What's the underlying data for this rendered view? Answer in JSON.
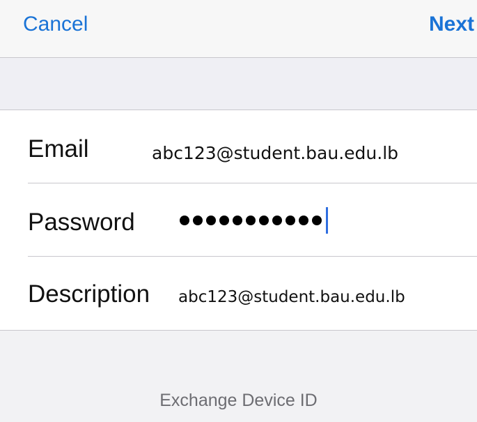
{
  "nav": {
    "cancel_label": "Cancel",
    "next_label": "Next"
  },
  "form": {
    "email": {
      "label": "Email",
      "value": "abc123@student.bau.edu.lb"
    },
    "password": {
      "label": "Password",
      "masked_length": 11
    },
    "description": {
      "label": "Description",
      "value": "abc123@student.bau.edu.lb"
    }
  },
  "footer": {
    "label": "Exchange Device ID"
  },
  "colors": {
    "accent": "#1a73d6",
    "caret": "#2f6ee0",
    "background": "#efeff4",
    "separator": "#c8c7cc",
    "footer_text": "#6d6d72"
  }
}
